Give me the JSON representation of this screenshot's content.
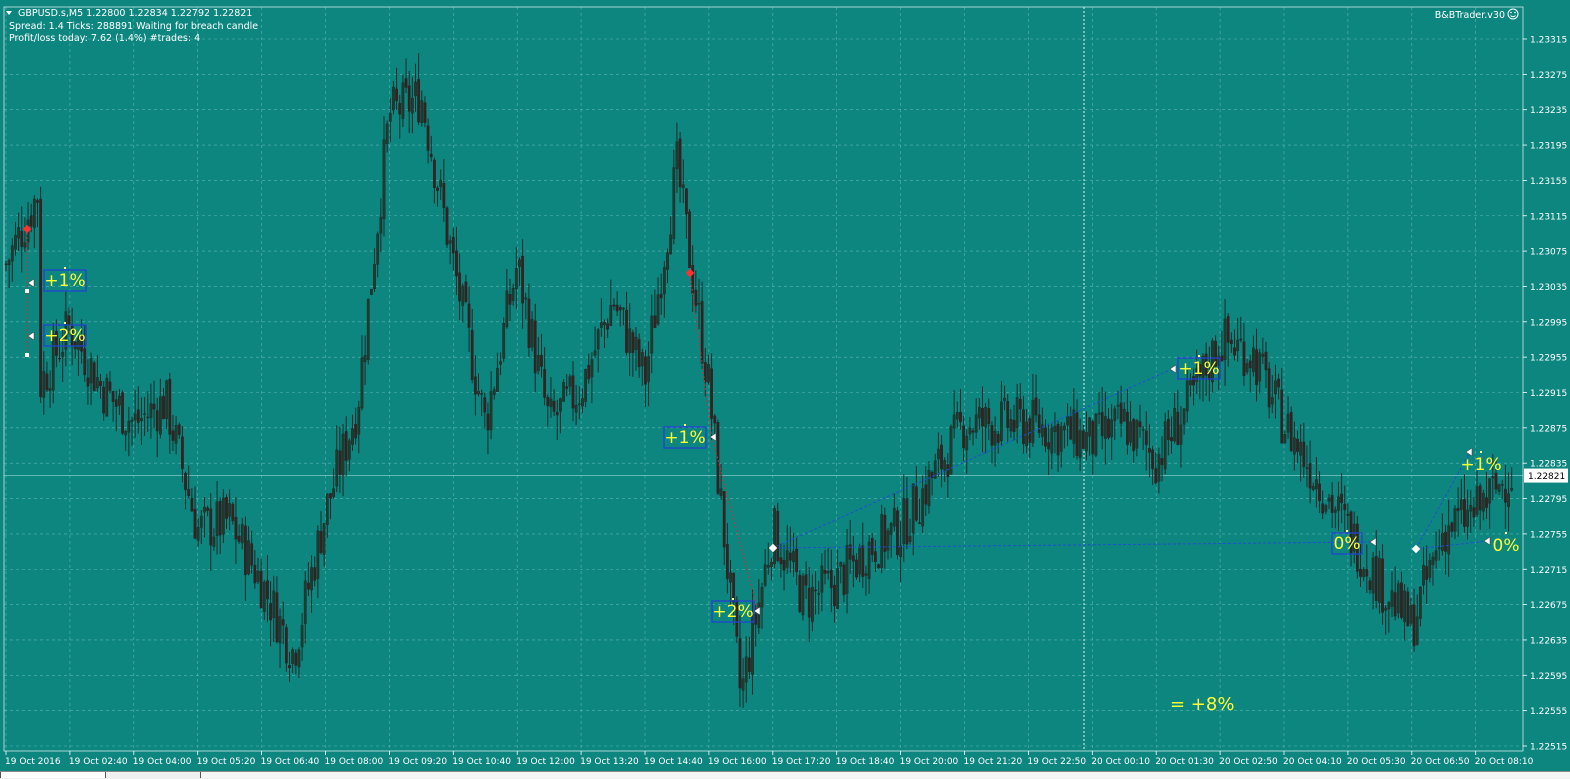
{
  "header": {
    "symbol_line": "GBPUSD.s,M5  1.22800 1.22834 1.22792 1.22821",
    "status_line": "Spread: 1.4  Ticks: 288891  Waiting for breach candle",
    "pnl_line": "Profit/loss today: 7.62 (1.4%)  #trades: 4"
  },
  "expert": {
    "name": "B&BTrader.v30",
    "smiley": "☺"
  },
  "price_axis": {
    "ticks": [
      "1.23315",
      "1.23275",
      "1.23235",
      "1.23195",
      "1.23155",
      "1.23115",
      "1.23075",
      "1.23035",
      "1.22995",
      "1.22955",
      "1.22915",
      "1.22875",
      "1.22835",
      "1.22795",
      "1.22755",
      "1.22715",
      "1.22675",
      "1.22635",
      "1.22595",
      "1.22555",
      "1.22515"
    ],
    "current_price": "1.22821"
  },
  "time_axis": {
    "ticks": [
      "19 Oct 2016",
      "19 Oct 02:40",
      "19 Oct 04:00",
      "19 Oct 05:20",
      "19 Oct 06:40",
      "19 Oct 08:00",
      "19 Oct 09:20",
      "19 Oct 10:40",
      "19 Oct 12:00",
      "19 Oct 13:20",
      "19 Oct 14:40",
      "19 Oct 16:00",
      "19 Oct 17:20",
      "19 Oct 18:40",
      "19 Oct 20:00",
      "19 Oct 21:20",
      "19 Oct 22:50",
      "20 Oct 00:10",
      "20 Oct 01:30",
      "20 Oct 02:50",
      "20 Oct 04:10",
      "20 Oct 05:30",
      "20 Oct 06:50",
      "20 Oct 08:10"
    ]
  },
  "trade_labels": [
    "+1%",
    "+2%",
    "+1%",
    "+2%",
    "+1%",
    "0%",
    "+1%",
    "0%"
  ],
  "total_label": "= +8%",
  "colors": {
    "background": "#0e8680",
    "grid": "#5fb6b0",
    "candle": "#1b2b28",
    "bear_candle": "#3a1f1f",
    "label_text": "#ffff33",
    "label_border": "#2244cc",
    "trade_line": "#1f4fd0",
    "loss_line": "#c83030",
    "axis_text": "#ffffff"
  },
  "chart_data": {
    "type": "candlestick",
    "title": "GBPUSD.s,M5",
    "ylim": [
      1.22515,
      1.23315
    ],
    "close_path": [
      [
        "19 Oct 2016",
        1.2306
      ],
      [
        "19 Oct 2016",
        1.2314
      ],
      [
        "19 Oct 2016",
        1.2292
      ],
      [
        "19 Oct 02:40",
        1.2299
      ],
      [
        "19 Oct 02:40",
        1.2292
      ],
      [
        "19 Oct 04:00",
        1.2288
      ],
      [
        "19 Oct 04:00",
        1.22905
      ],
      [
        "19 Oct 05:20",
        1.2276
      ],
      [
        "19 Oct 05:20",
        1.2277
      ],
      [
        "19 Oct 06:40",
        1.227
      ],
      [
        "19 Oct 06:40",
        1.2262
      ],
      [
        "19 Oct 08:00",
        1.2278
      ],
      [
        "19 Oct 08:00",
        1.229
      ],
      [
        "19 Oct 09:20",
        1.2323
      ],
      [
        "19 Oct 09:20",
        1.2325
      ],
      [
        "19 Oct 10:40",
        1.2306
      ],
      [
        "19 Oct 10:40",
        1.2288
      ],
      [
        "19 Oct 12:00",
        1.2306
      ],
      [
        "19 Oct 12:00",
        1.2288
      ],
      [
        "19 Oct 13:20",
        1.2292
      ],
      [
        "19 Oct 13:20",
        1.2302
      ],
      [
        "19 Oct 14:40",
        1.2293
      ],
      [
        "19 Oct 14:40",
        1.2317
      ],
      [
        "19 Oct 16:00",
        1.2292
      ],
      [
        "19 Oct 16:00",
        1.2257
      ],
      [
        "19 Oct 17:20",
        1.2276
      ],
      [
        "19 Oct 17:20",
        1.2268
      ],
      [
        "19 Oct 18:40",
        1.227
      ],
      [
        "19 Oct 18:40",
        1.2274
      ],
      [
        "19 Oct 20:00",
        1.2276
      ],
      [
        "19 Oct 20:00",
        1.2282
      ],
      [
        "19 Oct 21:20",
        1.2288
      ],
      [
        "19 Oct 21:20",
        1.2288
      ],
      [
        "19 Oct 22:50",
        1.2288
      ],
      [
        "19 Oct 22:50",
        1.2287
      ],
      [
        "20 Oct 00:10",
        1.2286
      ],
      [
        "20 Oct 00:10",
        1.2288
      ],
      [
        "20 Oct 01:30",
        1.2284
      ],
      [
        "20 Oct 01:30",
        1.229
      ],
      [
        "20 Oct 02:50",
        1.22975
      ],
      [
        "20 Oct 02:50",
        1.2296
      ],
      [
        "20 Oct 04:10",
        1.2288
      ],
      [
        "20 Oct 04:10",
        1.2282
      ],
      [
        "20 Oct 05:30",
        1.2276
      ],
      [
        "20 Oct 05:30",
        1.227
      ],
      [
        "20 Oct 06:50",
        1.2265
      ],
      [
        "20 Oct 06:50",
        1.2276
      ],
      [
        "20 Oct 08:10",
        1.2278
      ],
      [
        "20 Oct 08:10",
        1.22821
      ]
    ]
  }
}
